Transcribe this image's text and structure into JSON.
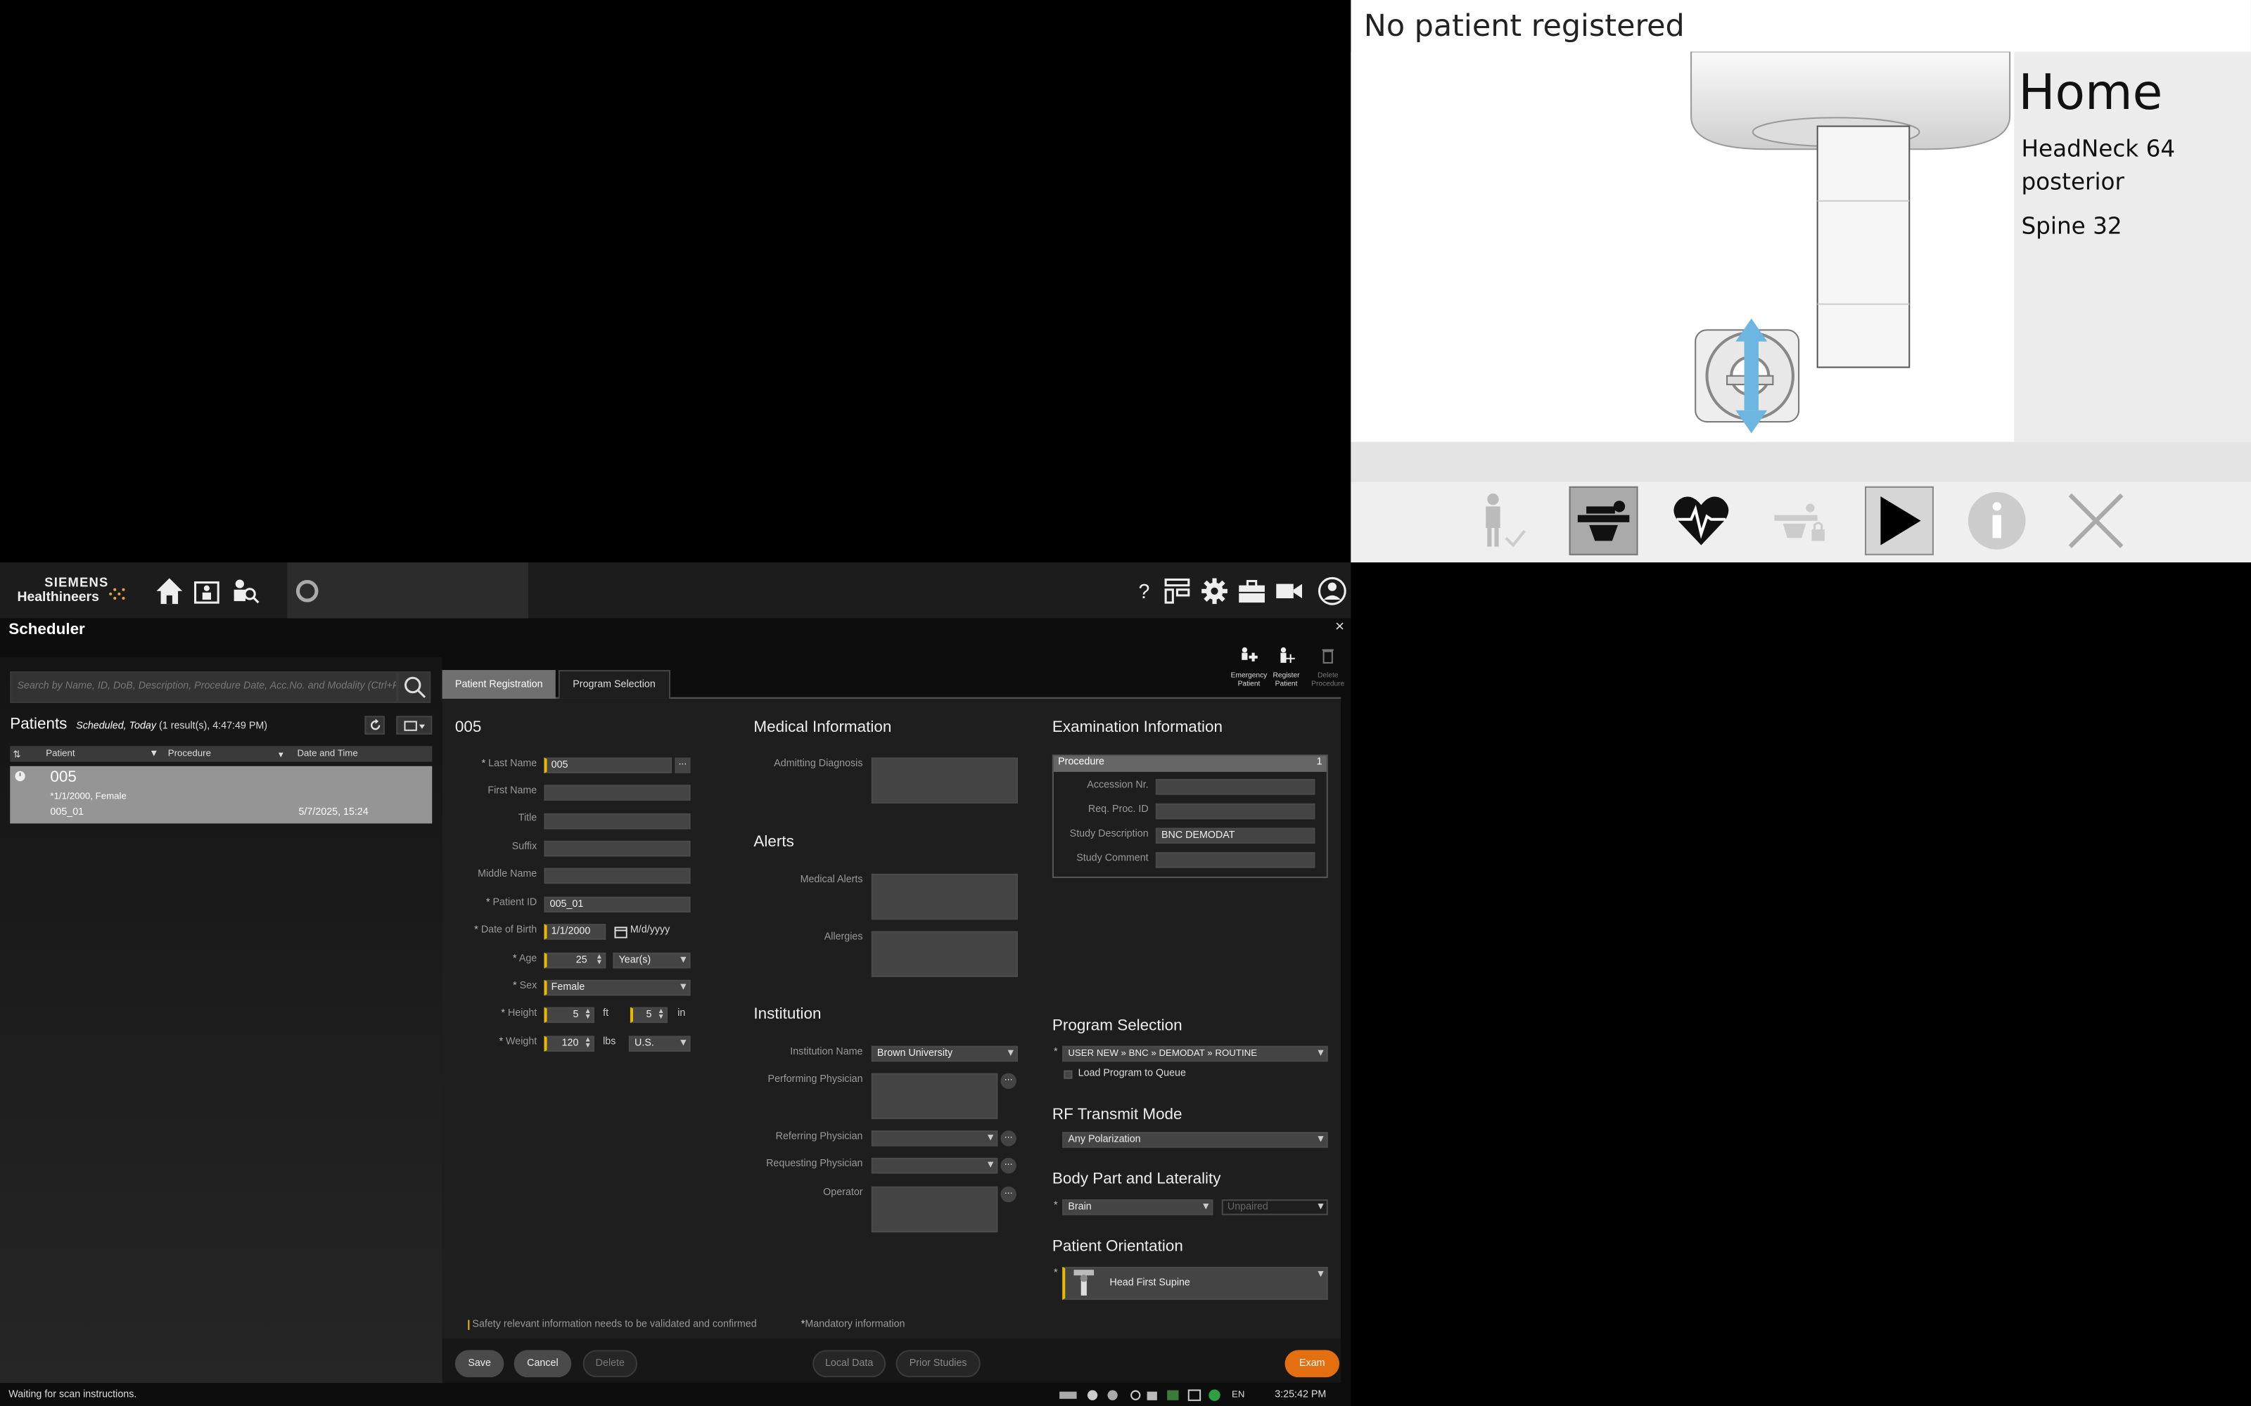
{
  "monitor": {
    "title": "No patient registered",
    "home_label": "Home",
    "coils": [
      "HeadNeck 64",
      "posterior",
      "Spine 32"
    ]
  },
  "app": {
    "brand_line1": "SIEMENS",
    "brand_line2": "Healthineers",
    "title": "Scheduler",
    "close_glyph": "×",
    "colors": {
      "accent": "#e6b800",
      "exam_button": "#e36f10",
      "row_selected": "#959595"
    }
  },
  "left": {
    "search_placeholder": "Search by Name, ID, DoB, Description, Procedure Date, Acc.No. and Modality (Ctrl+F)",
    "patients_title": "Patients",
    "filter_scope": "Scheduled, Today",
    "result_info": "(1 result(s), 4:47:49 PM)",
    "columns": [
      "Patient",
      "Procedure",
      "Date and Time"
    ],
    "row": {
      "name": "005",
      "dob_sex": "*1/1/2000, Female",
      "id": "005_01",
      "datetime": "5/7/2025, 15:24"
    }
  },
  "tabs": {
    "registration": "Patient Registration",
    "program": "Program Selection"
  },
  "actions": {
    "emergency": [
      "Emergency",
      "Patient"
    ],
    "register": [
      "Register",
      "Patient"
    ],
    "delete_proc": [
      "Delete",
      "Procedure"
    ]
  },
  "patient": {
    "header": "005",
    "labels": {
      "last_name": "Last Name",
      "first_name": "First Name",
      "title": "Title",
      "suffix": "Suffix",
      "middle_name": "Middle Name",
      "patient_id": "Patient ID",
      "dob": "Date of Birth",
      "age": "Age",
      "sex": "Sex",
      "height": "Height",
      "weight": "Weight"
    },
    "last_name": "005",
    "patient_id": "005_01",
    "dob": "1/1/2000",
    "dob_format": "M/d/yyyy",
    "age": "25",
    "age_unit": "Year(s)",
    "sex": "Female",
    "height_ft": "5",
    "height_ft_unit": "ft",
    "height_in": "5",
    "height_in_unit": "in",
    "weight": "120",
    "weight_unit": "lbs",
    "weight_system": "U.S."
  },
  "medical": {
    "title": "Medical Information",
    "admitting_diagnosis": "Admitting Diagnosis"
  },
  "alerts": {
    "title": "Alerts",
    "medical_alerts": "Medical Alerts",
    "allergies": "Allergies"
  },
  "institution": {
    "title": "Institution",
    "labels": {
      "name": "Institution Name",
      "performing": "Performing Physician",
      "referring": "Referring Physician",
      "requesting": "Requesting Physician",
      "operator": "Operator"
    },
    "name": "Brown University"
  },
  "exam": {
    "title": "Examination Information",
    "procedure_label": "Procedure",
    "procedure_count": "1",
    "labels": {
      "accession": "Accession Nr.",
      "req_proc": "Req. Proc. ID",
      "study_desc": "Study Description",
      "study_comment": "Study Comment"
    },
    "study_desc": "BNC DEMODAT"
  },
  "program": {
    "title": "Program Selection",
    "path": [
      "USER NEW",
      "BNC",
      "DEMODAT",
      "ROUTINE"
    ],
    "separator": "»",
    "load_queue": "Load Program to Queue"
  },
  "rf": {
    "title": "RF Transmit Mode",
    "value": "Any Polarization"
  },
  "body_part": {
    "title": "Body Part and Laterality",
    "value": "Brain",
    "laterality": "Unpaired"
  },
  "orientation": {
    "title": "Patient Orientation",
    "value": "Head First Supine"
  },
  "footer_notes": {
    "safety": "Safety relevant information needs to be validated and confirmed",
    "mandatory": "Mandatory information",
    "asterisk": "*"
  },
  "buttons": {
    "save": "Save",
    "cancel": "Cancel",
    "delete": "Delete",
    "local_data": "Local Data",
    "prior_studies": "Prior Studies",
    "exam": "Exam",
    "ellipsis": "..."
  },
  "status": {
    "message": "Waiting for scan instructions.",
    "lang": "EN",
    "time": "3:25:42 PM"
  }
}
